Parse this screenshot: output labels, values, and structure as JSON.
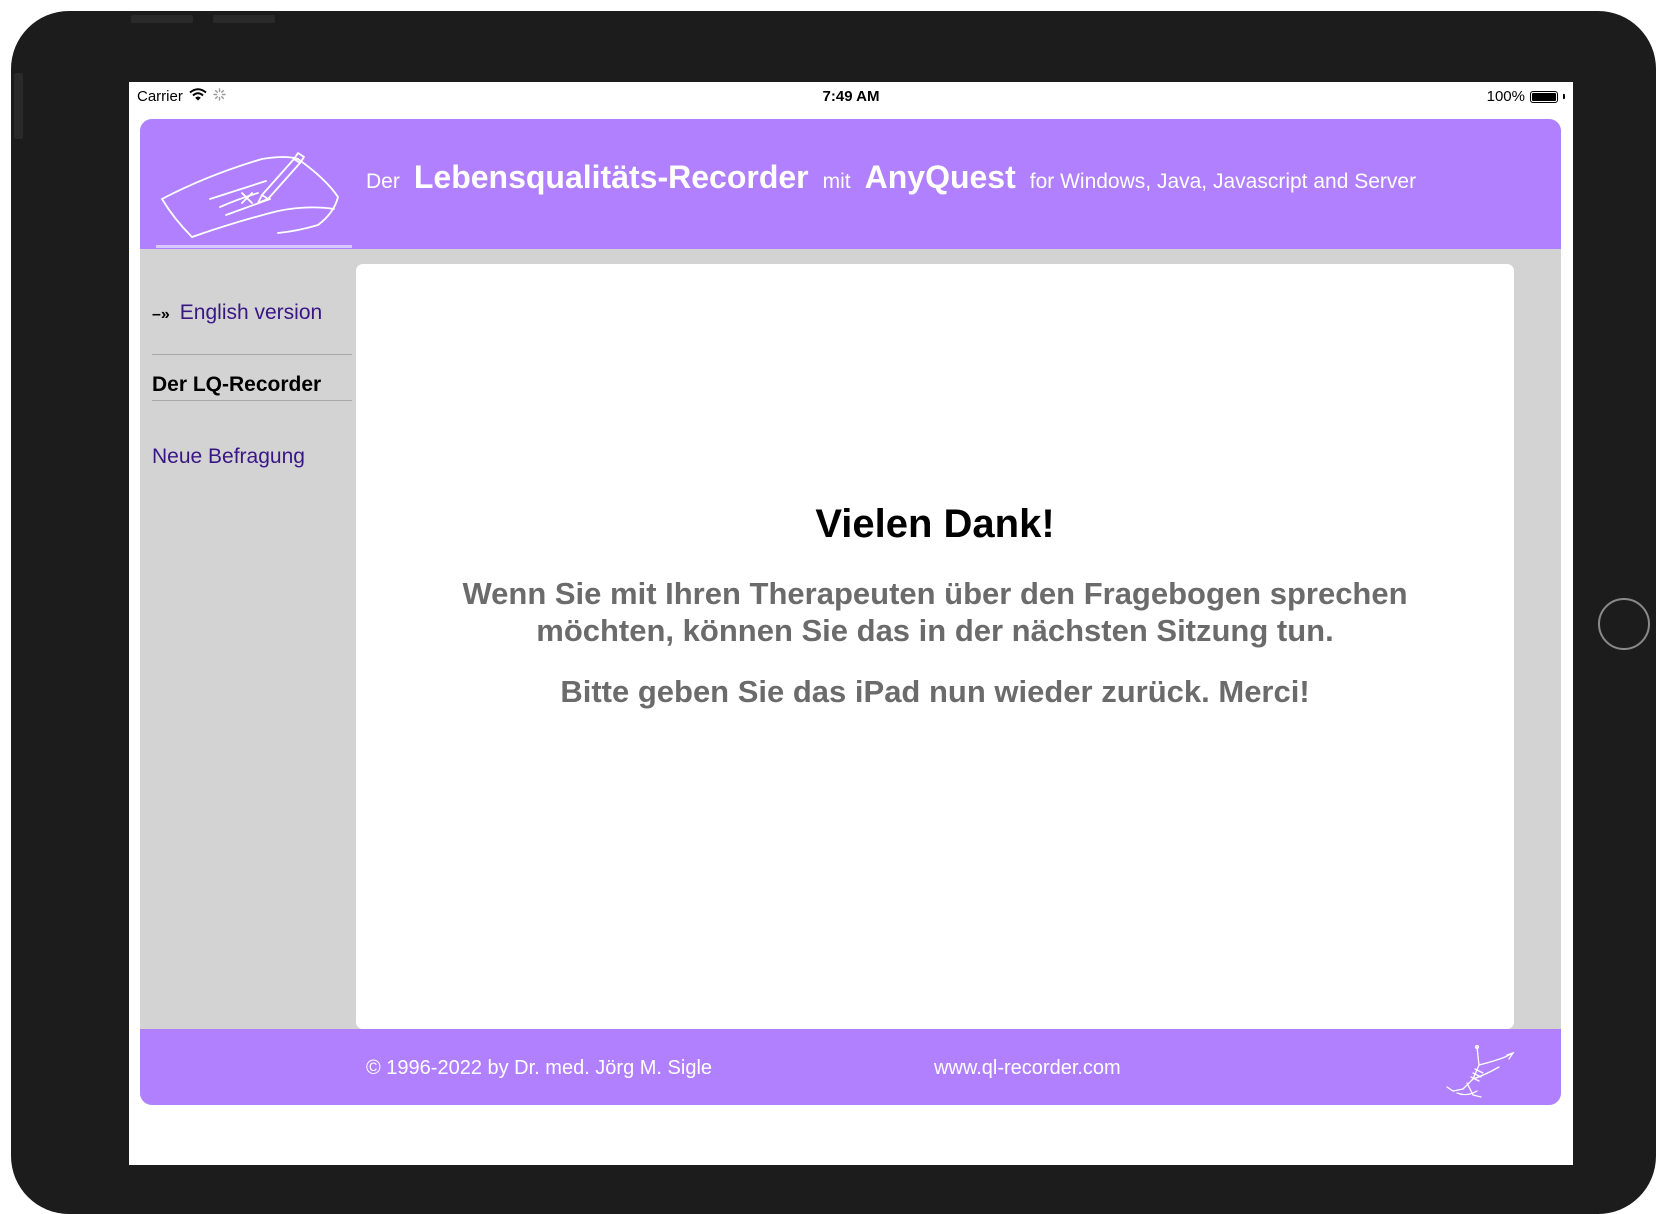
{
  "status_bar": {
    "carrier": "Carrier",
    "time": "7:49 AM",
    "battery_text": "100%",
    "battery_level": 1.0
  },
  "header": {
    "prefix": "Der",
    "title": "Lebensqualitäts-Recorder",
    "middle": "mit",
    "product": "AnyQuest",
    "suffix": "for Windows, Java, Javascript and Server"
  },
  "sidebar": {
    "lang_arrow": "–»",
    "lang_link": "English version",
    "section_title": "Der LQ-Recorder",
    "new_survey_link": "Neue Befragung"
  },
  "main": {
    "title": "Vielen Dank!",
    "message_line1": "Wenn Sie mit Ihren Therapeuten über den Fragebogen sprechen",
    "message_line2": "möchten, können Sie das in der nächsten Sitzung tun.",
    "message_return": "Bitte geben Sie das iPad nun wieder zurück. Merci!"
  },
  "footer": {
    "copyright": "© 1996-2022 by  Dr. med. Jörg M. Sigle",
    "url": "www.ql-recorder.com"
  },
  "colors": {
    "brand_purple": "#b080fe",
    "sidebar_gray": "#d3d3d3",
    "link_purple": "#3a1685",
    "message_gray": "#6b6b6b"
  },
  "icons": {
    "logo": "pen-on-paper-sketch-icon",
    "footer_deco": "decorative-sketch-icon",
    "wifi": "wifi-icon",
    "activity": "activity-spinner-icon",
    "battery": "battery-icon"
  }
}
